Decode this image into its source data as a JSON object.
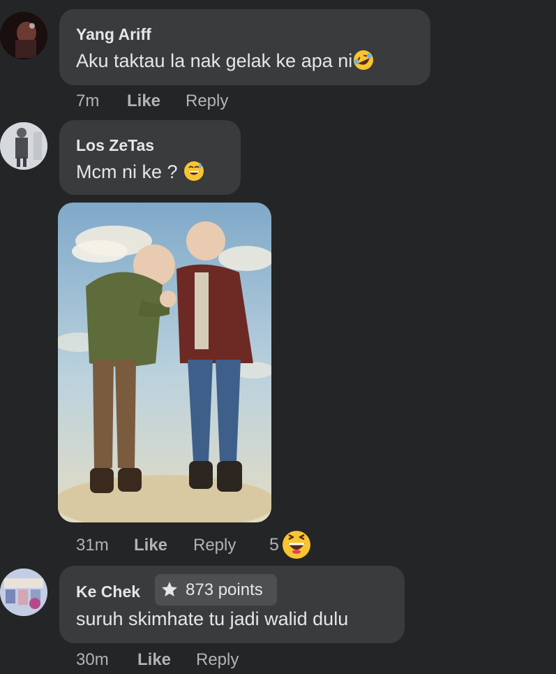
{
  "comments": [
    {
      "author": "Yang Ariff",
      "text": "Aku taktau la nak gelak ke apa ni",
      "emoji_icon": "rolling-on-floor-laughing-emoji",
      "time": "7m",
      "like_label": "Like",
      "reply_label": "Reply"
    },
    {
      "author": "Los ZeTas",
      "text": "Mcm ni ke ?",
      "emoji_icon": "grinning-sweat-emoji",
      "image_description": "Illustration of two bald men, one kissing the other's hand",
      "time": "31m",
      "like_label": "Like",
      "reply_label": "Reply",
      "reaction_count": "5",
      "reaction_icon": "laughing-reaction-emoji"
    },
    {
      "author": "Ke Chek",
      "badge": {
        "icon": "star-icon",
        "text": "873 points"
      },
      "text": "suruh skimhate tu jadi walid dulu",
      "time": "30m",
      "like_label": "Like",
      "reply_label": "Reply"
    }
  ],
  "colors": {
    "background": "#242526",
    "bubble": "#3a3b3c",
    "primary_text": "#e4e6eb",
    "secondary_text": "#b0b3b8",
    "badge_bg": "#4e4f50"
  }
}
